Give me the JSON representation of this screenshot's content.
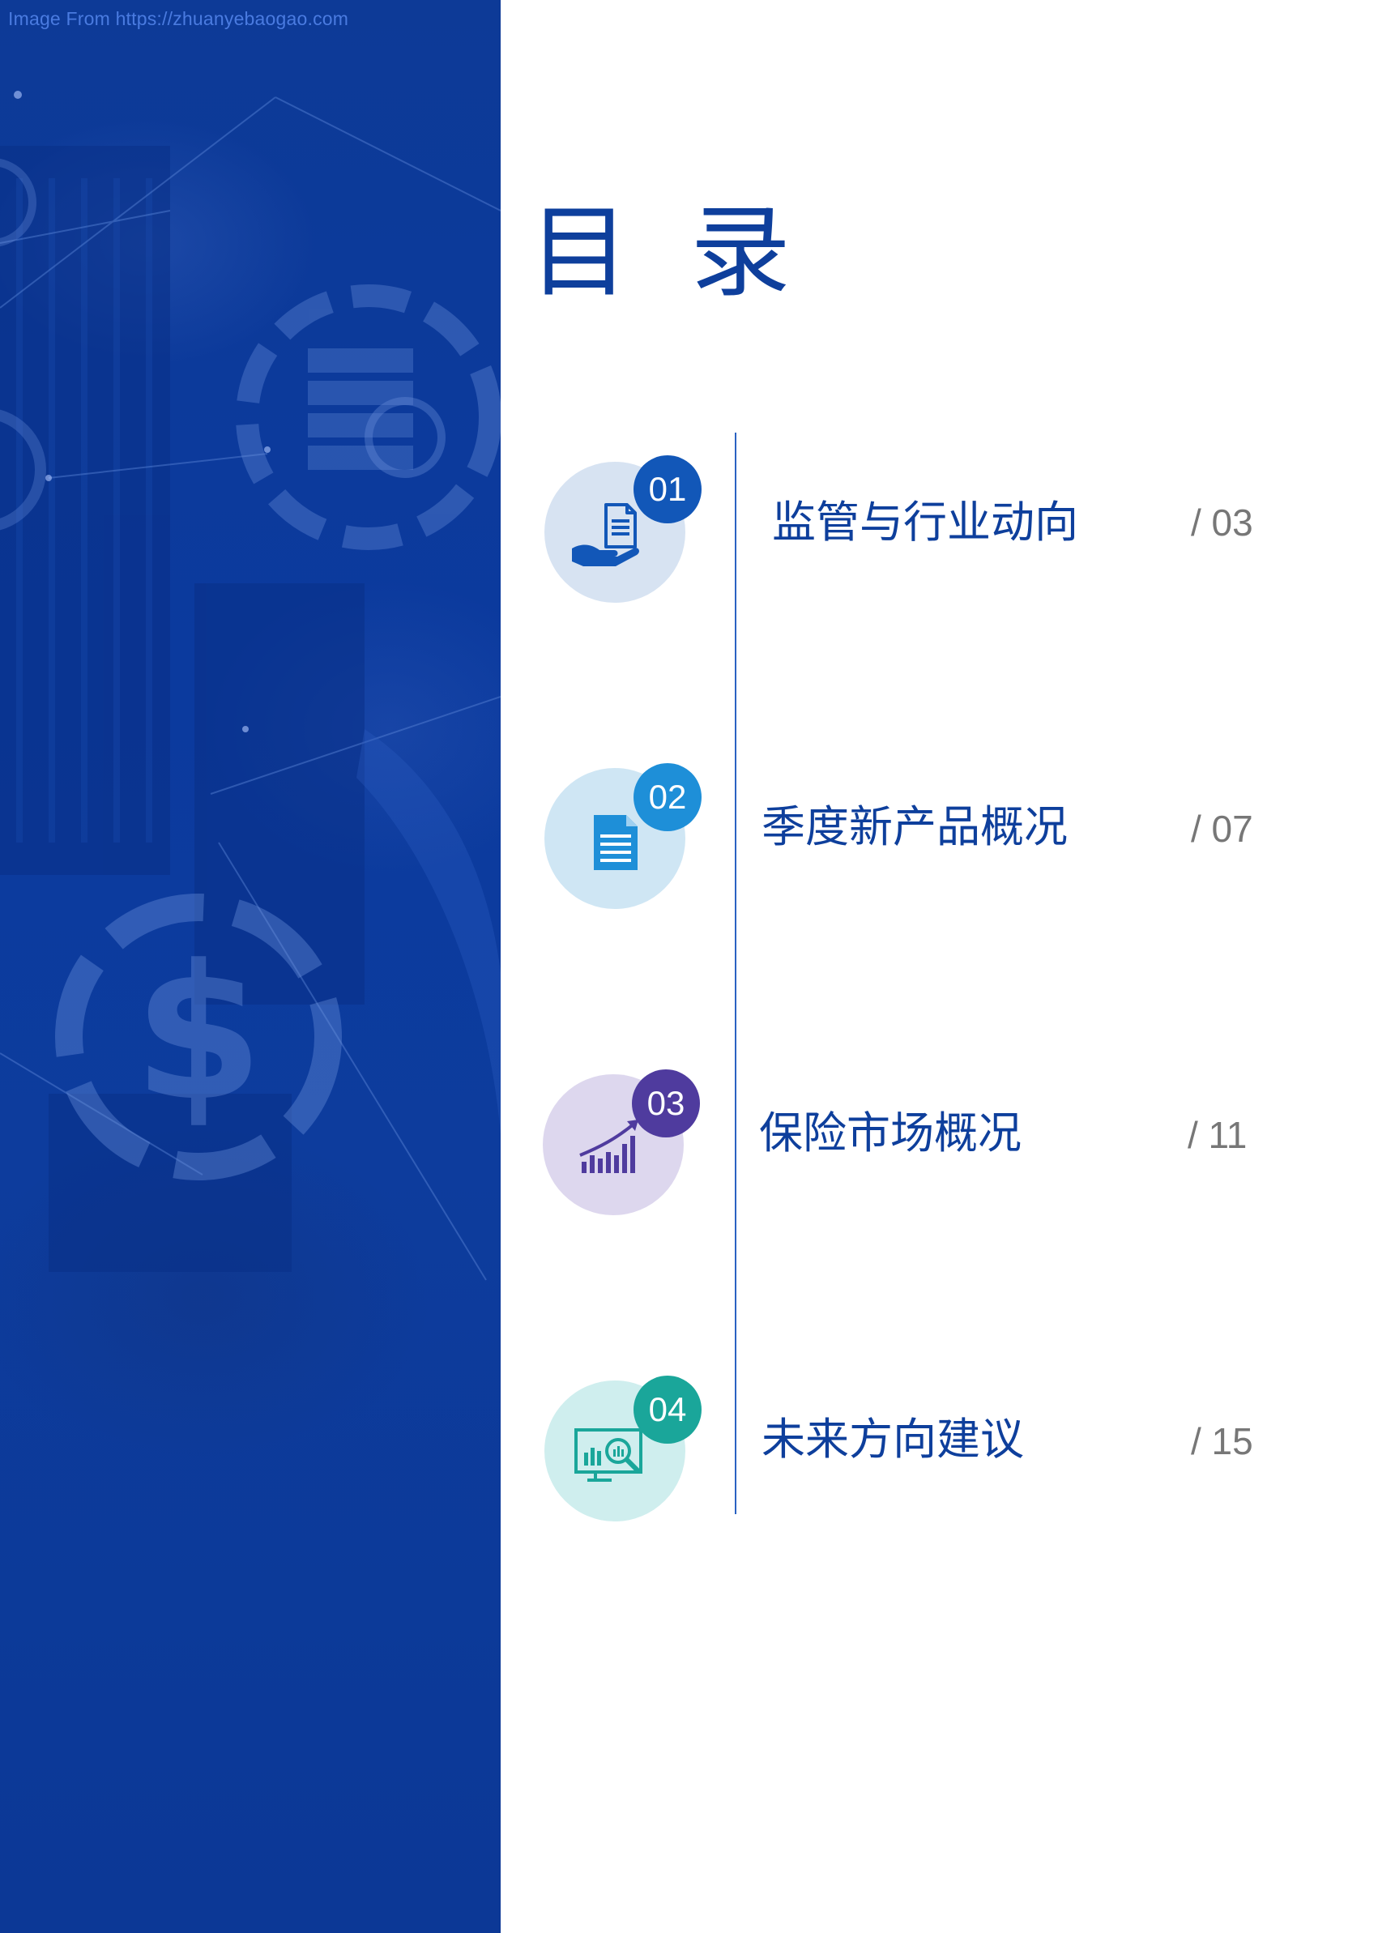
{
  "watermark": "Image From https://zhuanyebaogao.com",
  "title": "目录",
  "colors": {
    "panel_blue": "#0b3a9e",
    "title_blue": "#0e3f9c",
    "page_gray": "#777777",
    "item1_badge": "#1257b8",
    "item2_badge": "#1e8fd8",
    "item3_badge": "#4f3b9e",
    "item4_badge": "#1aa69a"
  },
  "toc": [
    {
      "number": "01",
      "label": "监管与行业动向",
      "page": "/ 03",
      "icon": "hand-document-icon"
    },
    {
      "number": "02",
      "label": "季度新产品概况",
      "page": "/ 07",
      "icon": "document-icon"
    },
    {
      "number": "03",
      "label": "保险市场概况",
      "page": "/ 11",
      "icon": "growth-chart-icon"
    },
    {
      "number": "04",
      "label": "未来方向建议",
      "page": "/ 15",
      "icon": "chart-magnifier-icon"
    }
  ]
}
